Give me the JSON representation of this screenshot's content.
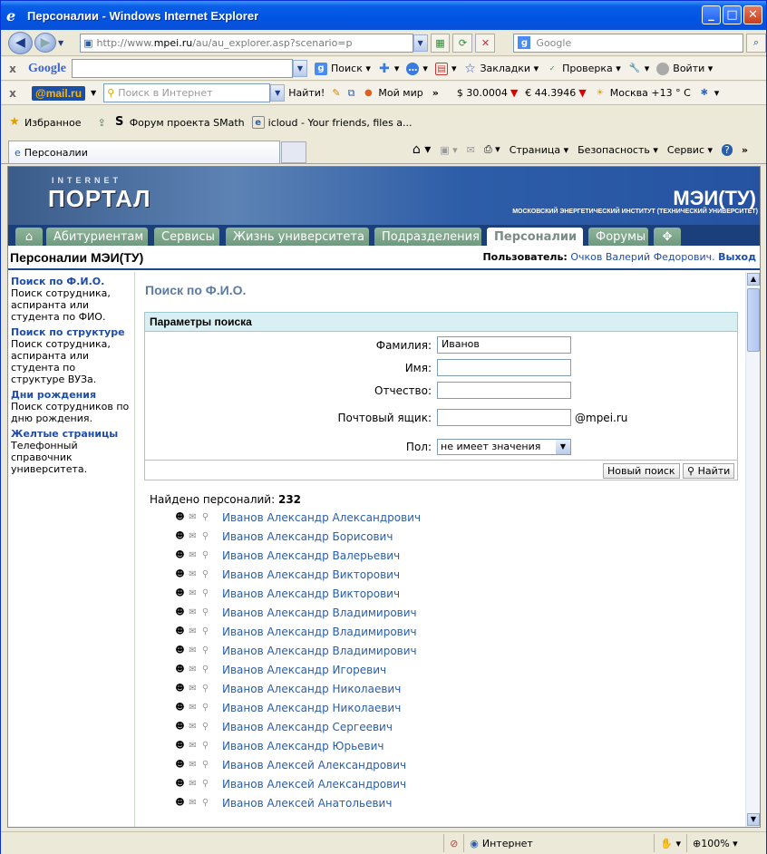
{
  "window": {
    "title": "Персоналии - Windows Internet Explorer"
  },
  "address": {
    "prefix": "http://www.",
    "domain": "mpei.ru",
    "path": "/au/au_explorer.asp?scenario=p"
  },
  "search_box": {
    "placeholder": "Google"
  },
  "google_bar": {
    "logo": "Google",
    "search": "Поиск",
    "bookmarks": "Закладки",
    "check": "Проверка",
    "login": "Войти"
  },
  "mail_bar": {
    "logo": "@mail.ru",
    "placeholder": "Поиск в Интернет",
    "find": "Найти!",
    "myworld": "Мой мир",
    "usd": "$ 30.0004",
    "eur": "€ 44.3946",
    "weather": "Москва +13 ° C"
  },
  "favorites_bar": {
    "favorites": "Избранное",
    "link1": "Форум проекта SMath",
    "link2": "icloud - Your friends, files a..."
  },
  "tab": {
    "label": "Персоналии"
  },
  "command_bar": {
    "page": "Страница",
    "security": "Безопасность",
    "tools": "Сервис"
  },
  "banner": {
    "internet": "INTERNET",
    "portal": "ПОРТАЛ",
    "mei": "МЭИ(ТУ)",
    "mei_sub": "МОСКОВСКИЙ ЭНЕРГЕТИЧЕСКИЙ ИНСТИТУТ (ТЕХНИЧЕСКИЙ УНИВЕРСИТЕТ)"
  },
  "menu": [
    "Абитуриентам",
    "Сервисы",
    "Жизнь университета",
    "Подразделения",
    "Персоналии",
    "Форумы"
  ],
  "header": {
    "title": "Персоналии МЭИ(ТУ)",
    "user_label": "Пользователь:",
    "user_name": "Очков Валерий Федорович.",
    "logout": "Выход"
  },
  "sidebar": [
    {
      "title": "Поиск по Ф.И.О.",
      "desc": "Поиск сотрудника, аспиранта или студента по ФИО."
    },
    {
      "title": "Поиск по структуре",
      "desc": "Поиск сотрудника, аспиранта или студента по структуре ВУЗа."
    },
    {
      "title": "Дни рождения",
      "desc": "Поиск сотрудников по дню рождения."
    },
    {
      "title": "Желтые страницы",
      "desc": "Телефонный справочник университета."
    }
  ],
  "search": {
    "title": "Поиск по Ф.И.О.",
    "params_header": "Параметры поиска",
    "surname_label": "Фамилия:",
    "surname_value": "Иванов",
    "name_label": "Имя:",
    "patronymic_label": "Отчество:",
    "mail_label": "Почтовый ящик:",
    "mail_suffix": "@mpei.ru",
    "gender_label": "Пол:",
    "gender_value": "не имеет значения",
    "new_search": "Новый поиск",
    "find": "Найти"
  },
  "results": {
    "found_label": "Найдено персоналий:",
    "count": "232",
    "people": [
      "Иванов Александр Александрович",
      "Иванов Александр Борисович",
      "Иванов Александр Валерьевич",
      "Иванов Александр Викторович",
      "Иванов Александр Викторович",
      "Иванов Александр Владимирович",
      "Иванов Александр Владимирович",
      "Иванов Александр Владимирович",
      "Иванов Александр Игоревич",
      "Иванов Александр Николаевич",
      "Иванов Александр Николаевич",
      "Иванов Александр Сергеевич",
      "Иванов Александр Юрьевич",
      "Иванов Алексей Александрович",
      "Иванов Алексей Александрович",
      "Иванов Алексей Анатольевич"
    ]
  },
  "status": {
    "zone": "Интернет",
    "zoom": "100%"
  }
}
